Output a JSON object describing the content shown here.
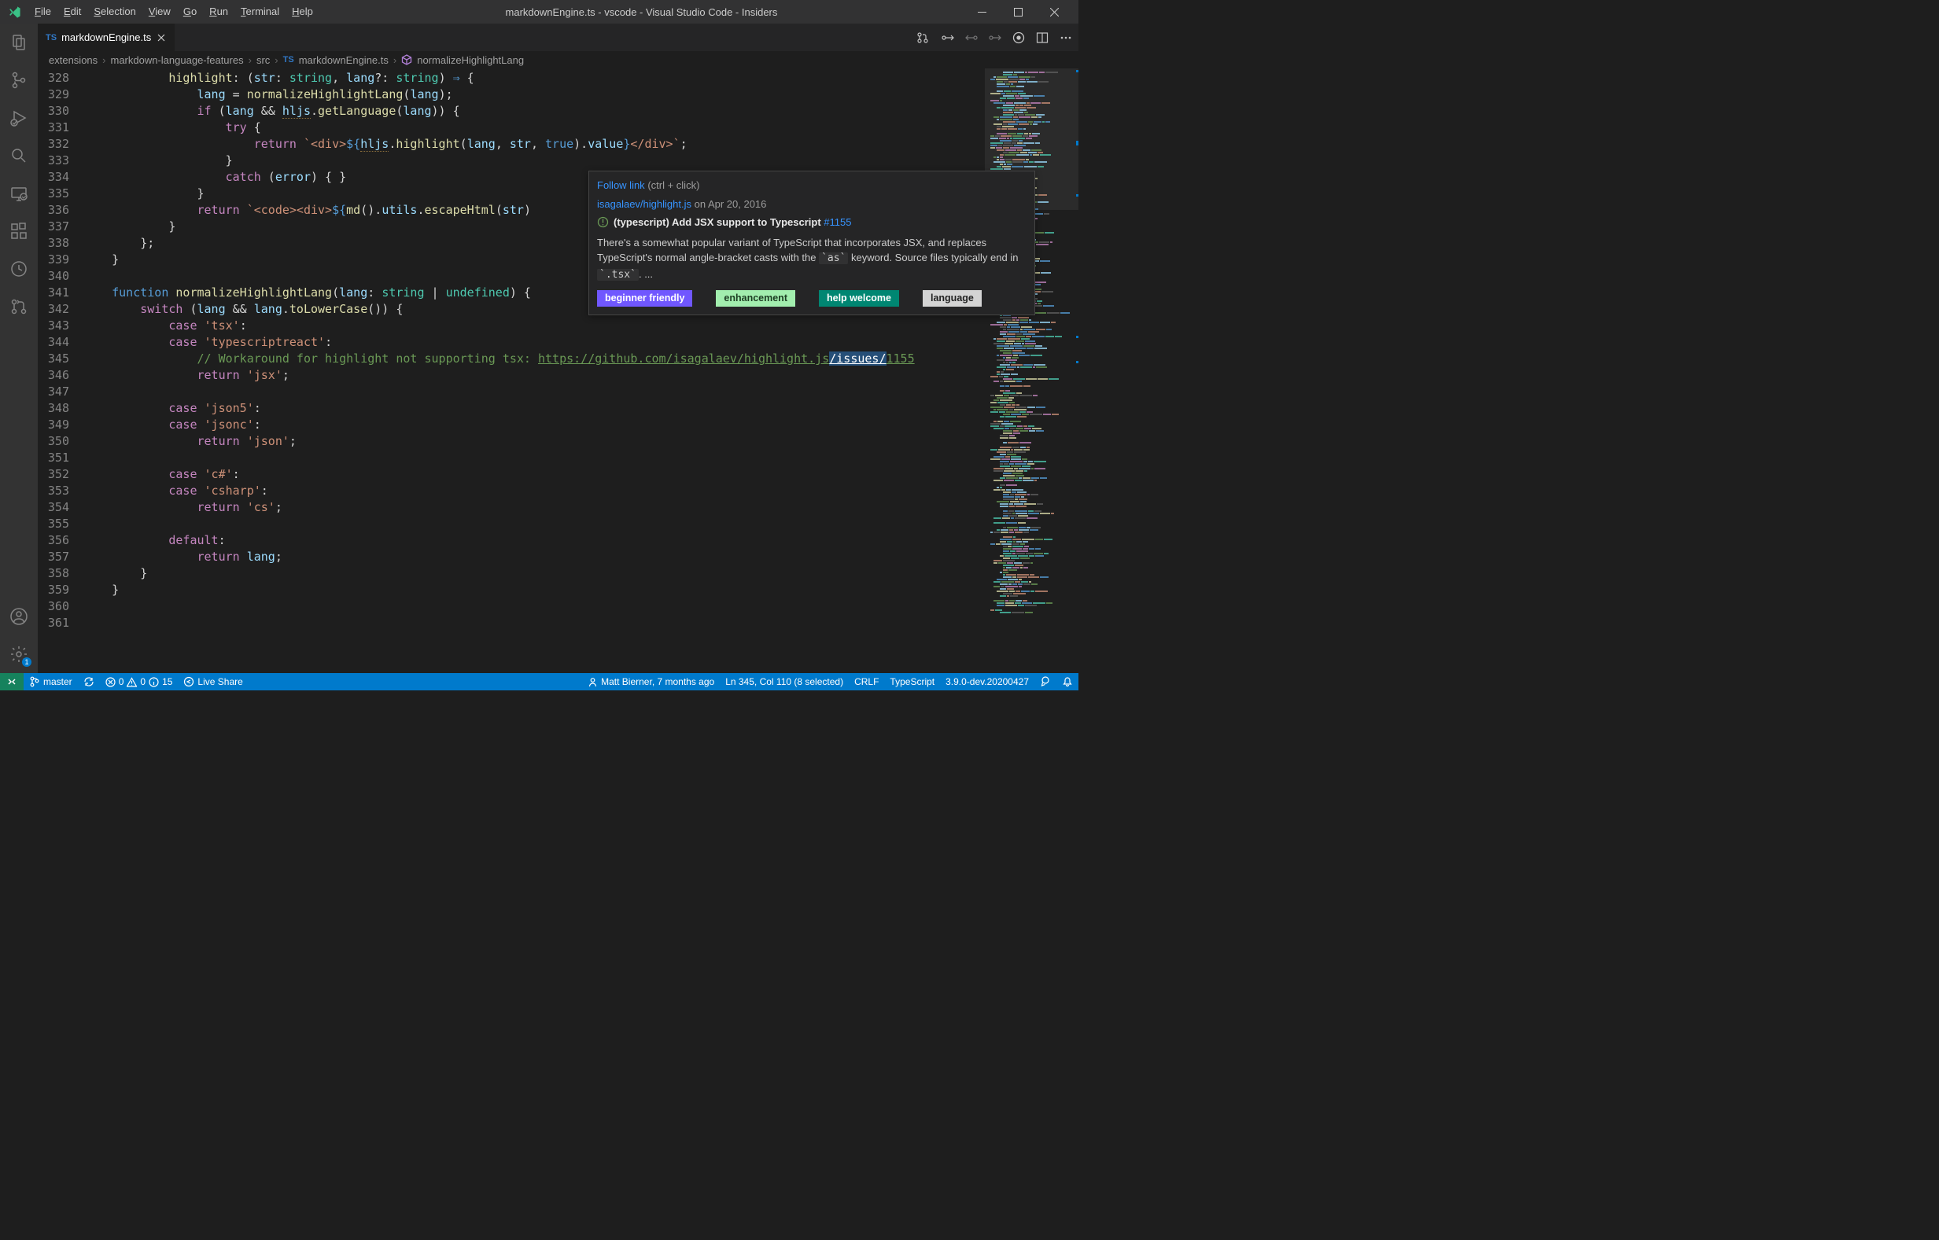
{
  "title": "markdownEngine.ts - vscode - Visual Studio Code - Insiders",
  "menu": [
    "File",
    "Edit",
    "Selection",
    "View",
    "Go",
    "Run",
    "Terminal",
    "Help"
  ],
  "activitybar": {
    "settings_badge": "1"
  },
  "tabs": [
    {
      "icon": "TS",
      "label": "markdownEngine.ts"
    }
  ],
  "breadcrumbs": {
    "parts": [
      "extensions",
      "markdown-language-features",
      "src"
    ],
    "file_icon": "TS",
    "file": "markdownEngine.ts",
    "symbol": "normalizeHighlightLang"
  },
  "code": {
    "first_line": 328,
    "lines": [
      {
        "segs": [
          {
            "t": "            ",
            "c": ""
          },
          {
            "t": "highlight",
            "c": "c-fn"
          },
          {
            "t": ": (",
            "c": ""
          },
          {
            "t": "str",
            "c": "c-var"
          },
          {
            "t": ": ",
            "c": ""
          },
          {
            "t": "string",
            "c": "c-type"
          },
          {
            "t": ", ",
            "c": ""
          },
          {
            "t": "lang",
            "c": "c-var"
          },
          {
            "t": "?: ",
            "c": ""
          },
          {
            "t": "string",
            "c": "c-type"
          },
          {
            "t": ") ",
            "c": ""
          },
          {
            "t": "⇒",
            "c": "c-kw"
          },
          {
            "t": " {",
            "c": ""
          }
        ]
      },
      {
        "segs": [
          {
            "t": "                ",
            "c": ""
          },
          {
            "t": "lang",
            "c": "c-var"
          },
          {
            "t": " = ",
            "c": ""
          },
          {
            "t": "normalizeHighlightLang",
            "c": "c-fn"
          },
          {
            "t": "(",
            "c": ""
          },
          {
            "t": "lang",
            "c": "c-var"
          },
          {
            "t": ");",
            "c": ""
          }
        ]
      },
      {
        "segs": [
          {
            "t": "                ",
            "c": ""
          },
          {
            "t": "if",
            "c": "c-kw2"
          },
          {
            "t": " (",
            "c": ""
          },
          {
            "t": "lang",
            "c": "c-var"
          },
          {
            "t": " && ",
            "c": ""
          },
          {
            "t": "hljs",
            "c": "c-var squiggle"
          },
          {
            "t": ".",
            "c": ""
          },
          {
            "t": "getLanguage",
            "c": "c-fn"
          },
          {
            "t": "(",
            "c": ""
          },
          {
            "t": "lang",
            "c": "c-var"
          },
          {
            "t": ")) {",
            "c": ""
          }
        ]
      },
      {
        "segs": [
          {
            "t": "                    ",
            "c": ""
          },
          {
            "t": "try",
            "c": "c-kw2"
          },
          {
            "t": " {",
            "c": ""
          }
        ]
      },
      {
        "segs": [
          {
            "t": "                        ",
            "c": ""
          },
          {
            "t": "return",
            "c": "c-kw2"
          },
          {
            "t": " ",
            "c": ""
          },
          {
            "t": "`<div>",
            "c": "c-str"
          },
          {
            "t": "${",
            "c": "c-esc"
          },
          {
            "t": "hljs",
            "c": "c-var squiggle"
          },
          {
            "t": ".",
            "c": ""
          },
          {
            "t": "highlight",
            "c": "c-fn"
          },
          {
            "t": "(",
            "c": ""
          },
          {
            "t": "lang",
            "c": "c-var"
          },
          {
            "t": ", ",
            "c": ""
          },
          {
            "t": "str",
            "c": "c-var"
          },
          {
            "t": ", ",
            "c": ""
          },
          {
            "t": "true",
            "c": "c-kw"
          },
          {
            "t": ").",
            "c": ""
          },
          {
            "t": "value",
            "c": "c-var"
          },
          {
            "t": "}",
            "c": "c-esc"
          },
          {
            "t": "</div>`",
            "c": "c-str"
          },
          {
            "t": ";",
            "c": ""
          }
        ]
      },
      {
        "segs": [
          {
            "t": "                    }",
            "c": ""
          }
        ]
      },
      {
        "segs": [
          {
            "t": "                    ",
            "c": ""
          },
          {
            "t": "catch",
            "c": "c-kw2"
          },
          {
            "t": " (",
            "c": ""
          },
          {
            "t": "error",
            "c": "c-var"
          },
          {
            "t": ") { }",
            "c": ""
          }
        ]
      },
      {
        "segs": [
          {
            "t": "                }",
            "c": ""
          }
        ]
      },
      {
        "segs": [
          {
            "t": "                ",
            "c": ""
          },
          {
            "t": "return",
            "c": "c-kw2"
          },
          {
            "t": " ",
            "c": ""
          },
          {
            "t": "`<code><div>",
            "c": "c-str"
          },
          {
            "t": "${",
            "c": "c-esc"
          },
          {
            "t": "md",
            "c": "c-fn"
          },
          {
            "t": "().",
            "c": ""
          },
          {
            "t": "utils",
            "c": "c-var"
          },
          {
            "t": ".",
            "c": ""
          },
          {
            "t": "escapeHtml",
            "c": "c-fn"
          },
          {
            "t": "(",
            "c": ""
          },
          {
            "t": "str",
            "c": "c-var"
          },
          {
            "t": ")",
            "c": ""
          }
        ]
      },
      {
        "segs": [
          {
            "t": "            }",
            "c": ""
          }
        ]
      },
      {
        "segs": [
          {
            "t": "        };",
            "c": ""
          }
        ]
      },
      {
        "segs": [
          {
            "t": "    }",
            "c": ""
          }
        ]
      },
      {
        "segs": []
      },
      {
        "segs": [
          {
            "t": "    ",
            "c": ""
          },
          {
            "t": "function",
            "c": "c-kw"
          },
          {
            "t": " ",
            "c": ""
          },
          {
            "t": "normalizeHighlightLang",
            "c": "c-fn"
          },
          {
            "t": "(",
            "c": ""
          },
          {
            "t": "lang",
            "c": "c-var"
          },
          {
            "t": ": ",
            "c": ""
          },
          {
            "t": "string",
            "c": "c-type"
          },
          {
            "t": " | ",
            "c": ""
          },
          {
            "t": "undefined",
            "c": "c-type"
          },
          {
            "t": ") {",
            "c": ""
          }
        ]
      },
      {
        "segs": [
          {
            "t": "        ",
            "c": ""
          },
          {
            "t": "switch",
            "c": "c-kw2"
          },
          {
            "t": " (",
            "c": ""
          },
          {
            "t": "lang",
            "c": "c-var"
          },
          {
            "t": " && ",
            "c": ""
          },
          {
            "t": "lang",
            "c": "c-var"
          },
          {
            "t": ".",
            "c": ""
          },
          {
            "t": "toLowerCase",
            "c": "c-fn"
          },
          {
            "t": "()) {",
            "c": ""
          }
        ]
      },
      {
        "segs": [
          {
            "t": "            ",
            "c": ""
          },
          {
            "t": "case",
            "c": "c-kw2"
          },
          {
            "t": " ",
            "c": ""
          },
          {
            "t": "'tsx'",
            "c": "c-str"
          },
          {
            "t": ":",
            "c": ""
          }
        ]
      },
      {
        "segs": [
          {
            "t": "            ",
            "c": ""
          },
          {
            "t": "case",
            "c": "c-kw2"
          },
          {
            "t": " ",
            "c": ""
          },
          {
            "t": "'typescriptreact'",
            "c": "c-str"
          },
          {
            "t": ":",
            "c": ""
          }
        ]
      },
      {
        "segs": [
          {
            "t": "                ",
            "c": ""
          },
          {
            "t": "// Workaround for highlight not supporting tsx: ",
            "c": "c-com"
          },
          {
            "t": "https://github.com/isagalaev/highlight.js",
            "c": "c-link"
          },
          {
            "t": "/issues/",
            "c": "c-link sel"
          },
          {
            "t": "1155",
            "c": "c-link"
          }
        ]
      },
      {
        "segs": [
          {
            "t": "                ",
            "c": ""
          },
          {
            "t": "return",
            "c": "c-kw2"
          },
          {
            "t": " ",
            "c": ""
          },
          {
            "t": "'jsx'",
            "c": "c-str"
          },
          {
            "t": ";",
            "c": ""
          }
        ]
      },
      {
        "segs": []
      },
      {
        "segs": [
          {
            "t": "            ",
            "c": ""
          },
          {
            "t": "case",
            "c": "c-kw2"
          },
          {
            "t": " ",
            "c": ""
          },
          {
            "t": "'json5'",
            "c": "c-str"
          },
          {
            "t": ":",
            "c": ""
          }
        ]
      },
      {
        "segs": [
          {
            "t": "            ",
            "c": ""
          },
          {
            "t": "case",
            "c": "c-kw2"
          },
          {
            "t": " ",
            "c": ""
          },
          {
            "t": "'jsonc'",
            "c": "c-str"
          },
          {
            "t": ":",
            "c": ""
          }
        ]
      },
      {
        "segs": [
          {
            "t": "                ",
            "c": ""
          },
          {
            "t": "return",
            "c": "c-kw2"
          },
          {
            "t": " ",
            "c": ""
          },
          {
            "t": "'json'",
            "c": "c-str"
          },
          {
            "t": ";",
            "c": ""
          }
        ]
      },
      {
        "segs": []
      },
      {
        "segs": [
          {
            "t": "            ",
            "c": ""
          },
          {
            "t": "case",
            "c": "c-kw2"
          },
          {
            "t": " ",
            "c": ""
          },
          {
            "t": "'c#'",
            "c": "c-str"
          },
          {
            "t": ":",
            "c": ""
          }
        ]
      },
      {
        "segs": [
          {
            "t": "            ",
            "c": ""
          },
          {
            "t": "case",
            "c": "c-kw2"
          },
          {
            "t": " ",
            "c": ""
          },
          {
            "t": "'csharp'",
            "c": "c-str"
          },
          {
            "t": ":",
            "c": ""
          }
        ]
      },
      {
        "segs": [
          {
            "t": "                ",
            "c": ""
          },
          {
            "t": "return",
            "c": "c-kw2"
          },
          {
            "t": " ",
            "c": ""
          },
          {
            "t": "'cs'",
            "c": "c-str"
          },
          {
            "t": ";",
            "c": ""
          }
        ]
      },
      {
        "segs": []
      },
      {
        "segs": [
          {
            "t": "            ",
            "c": ""
          },
          {
            "t": "default",
            "c": "c-kw2"
          },
          {
            "t": ":",
            "c": ""
          }
        ]
      },
      {
        "segs": [
          {
            "t": "                ",
            "c": ""
          },
          {
            "t": "return",
            "c": "c-kw2"
          },
          {
            "t": " ",
            "c": ""
          },
          {
            "t": "lang",
            "c": "c-var"
          },
          {
            "t": ";",
            "c": ""
          }
        ]
      },
      {
        "segs": [
          {
            "t": "        }",
            "c": ""
          }
        ]
      },
      {
        "segs": [
          {
            "t": "    }",
            "c": ""
          }
        ]
      },
      {
        "segs": []
      },
      {
        "segs": []
      }
    ]
  },
  "hover": {
    "follow_link": "Follow link",
    "follow_hint": "(ctrl + click)",
    "repo": "isagalaev/highlight.js",
    "date": "on Apr 20, 2016",
    "title_prefix": "(typescript)",
    "title": "Add JSX support to Typescript",
    "issue": "#1155",
    "body_pre": "There's a somewhat popular variant of TypeScript that incorporates JSX, and replaces TypeScript's normal angle-bracket casts with the ",
    "body_code": "`as`",
    "body_mid": " keyword. Source files typically end in ",
    "body_code2": "`.tsx`",
    "body_post": ". ...",
    "labels": [
      {
        "text": "beginner friendly",
        "class": "lbl-beg"
      },
      {
        "text": "enhancement",
        "class": "lbl-enh"
      },
      {
        "text": "help welcome",
        "class": "lbl-hw"
      },
      {
        "text": "language",
        "class": "lbl-lang"
      }
    ]
  },
  "statusbar": {
    "branch": "master",
    "problems": {
      "err": "0",
      "warn": "0",
      "info": "15"
    },
    "liveshare": "Live Share",
    "blame": "Matt Bierner, 7 months ago",
    "cursor": "Ln 345, Col 110 (8 selected)",
    "eol": "CRLF",
    "lang": "TypeScript",
    "tsver": "3.9.0-dev.20200427"
  }
}
